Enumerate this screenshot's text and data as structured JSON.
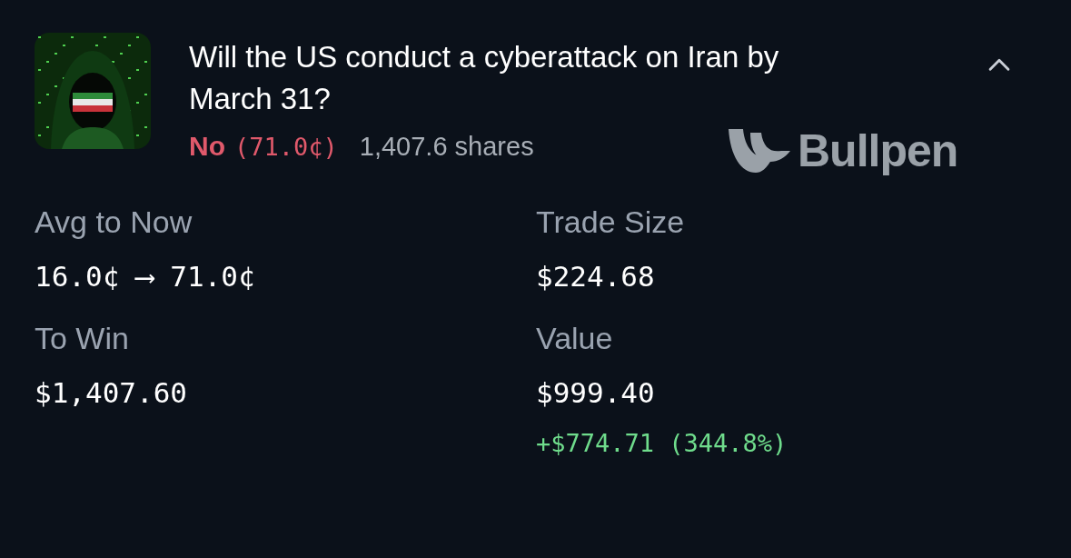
{
  "market": {
    "title": "Will the US conduct a cyberattack on Iran by March 31?",
    "expanded": true
  },
  "position": {
    "kind": "no",
    "outcome": "No",
    "price": "(71.0¢)",
    "shares": "1,407.6 shares"
  },
  "brand": {
    "name": "Bullpen"
  },
  "stats": [
    {
      "label": "Avg to Now",
      "value": "16.0¢ ⟶ 71.0¢"
    },
    {
      "label": "Trade Size",
      "value": "$224.68"
    },
    {
      "label": "To Win",
      "value": "$1,407.60"
    },
    {
      "label": "Value",
      "value": "$999.40",
      "change": {
        "kind": "gain",
        "text": "+$774.71 (344.8%)"
      }
    }
  ]
}
